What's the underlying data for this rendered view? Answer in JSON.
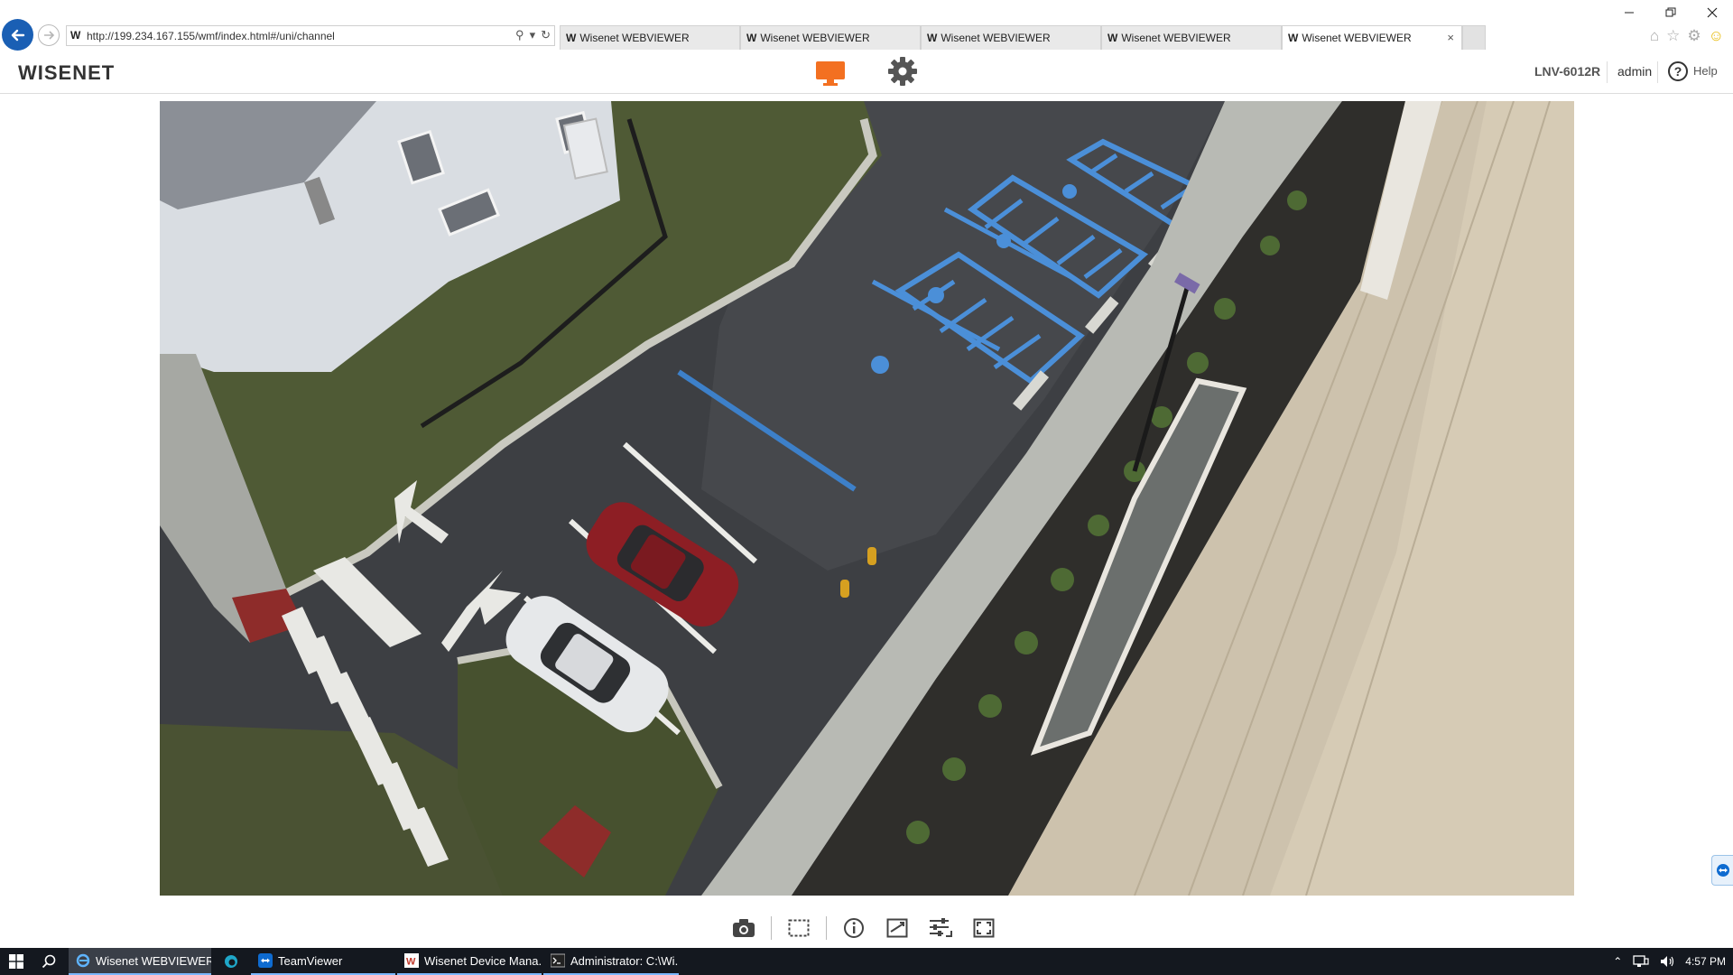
{
  "browser": {
    "url": "http://199.234.167.155/wmf/index.html#/uni/channel",
    "tabs": [
      {
        "title": "Wisenet WEBVIEWER",
        "active": false
      },
      {
        "title": "Wisenet WEBVIEWER",
        "active": false
      },
      {
        "title": "Wisenet WEBVIEWER",
        "active": false
      },
      {
        "title": "Wisenet WEBVIEWER",
        "active": false
      },
      {
        "title": "Wisenet WEBVIEWER",
        "active": true
      }
    ],
    "tab_icon": "W",
    "close_glyph": "×"
  },
  "header": {
    "logo": "WISENET",
    "device": "LNV-6012R",
    "user": "admin",
    "help_label": "Help",
    "help_glyph": "?",
    "accent_color": "#f37021"
  },
  "toolbar": {
    "buttons": [
      "camera-icon",
      "select-area-icon",
      "info-icon",
      "aspect-ratio-icon",
      "adjust-icon",
      "fullscreen-icon"
    ]
  },
  "taskbar": {
    "items": [
      {
        "label": "Wisenet WEBVIEWER ...",
        "icon": "ie-icon",
        "state": "active"
      },
      {
        "label": "",
        "icon": "edge-icon",
        "state": "pinned"
      },
      {
        "label": "TeamViewer",
        "icon": "teamviewer-icon",
        "state": "open"
      },
      {
        "label": "Wisenet Device Mana...",
        "icon": "wisenet-icon",
        "state": "open"
      },
      {
        "label": "Administrator: C:\\Wi...",
        "icon": "cmd-icon",
        "state": "open"
      }
    ],
    "clock": "4:57 PM"
  }
}
